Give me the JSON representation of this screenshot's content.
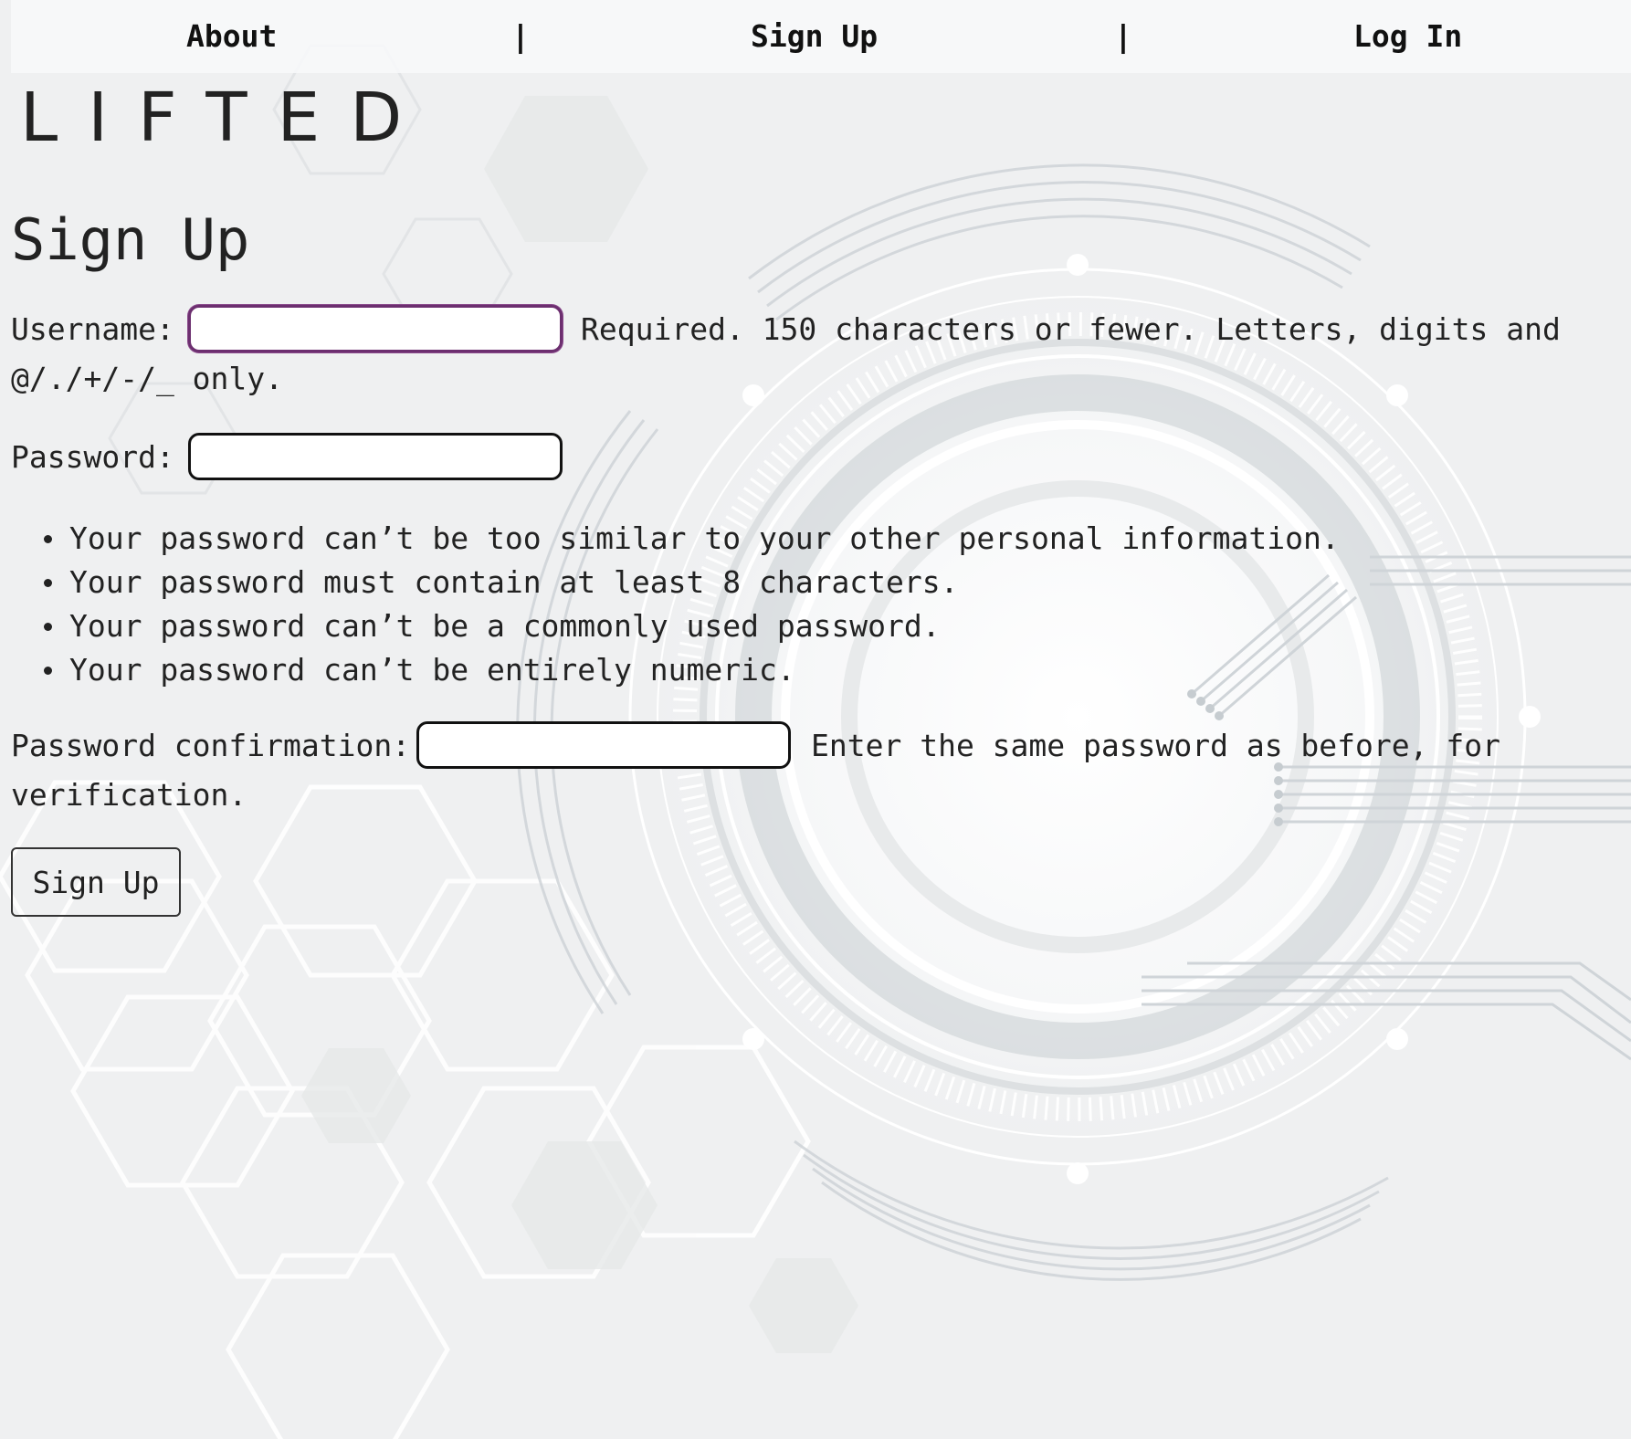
{
  "nav": {
    "about": "About",
    "sep1": "|",
    "signup": "Sign Up",
    "sep2": "|",
    "login": "Log In"
  },
  "logo": "LIFTED",
  "form": {
    "title": "Sign Up",
    "username": {
      "label": "Username:",
      "value": "",
      "help_line1": "Required. 150 characters or fewer. Letters, digits and",
      "help_line2": "@/./+/-/_ only."
    },
    "password": {
      "label": "Password:",
      "value": "",
      "rules": [
        "Your password can’t be too similar to your other personal information.",
        "Your password must contain at least 8 characters.",
        "Your password can’t be a commonly used password.",
        "Your password can’t be entirely numeric."
      ]
    },
    "password_confirmation": {
      "label": "Password confirmation:",
      "value": "",
      "help_line1": "Enter the same password as before, for",
      "help_line2": "verification."
    },
    "submit_label": "Sign Up"
  },
  "colors": {
    "background": "#f1f2f3",
    "focus_border": "#6c2f6f",
    "text": "#222222"
  }
}
